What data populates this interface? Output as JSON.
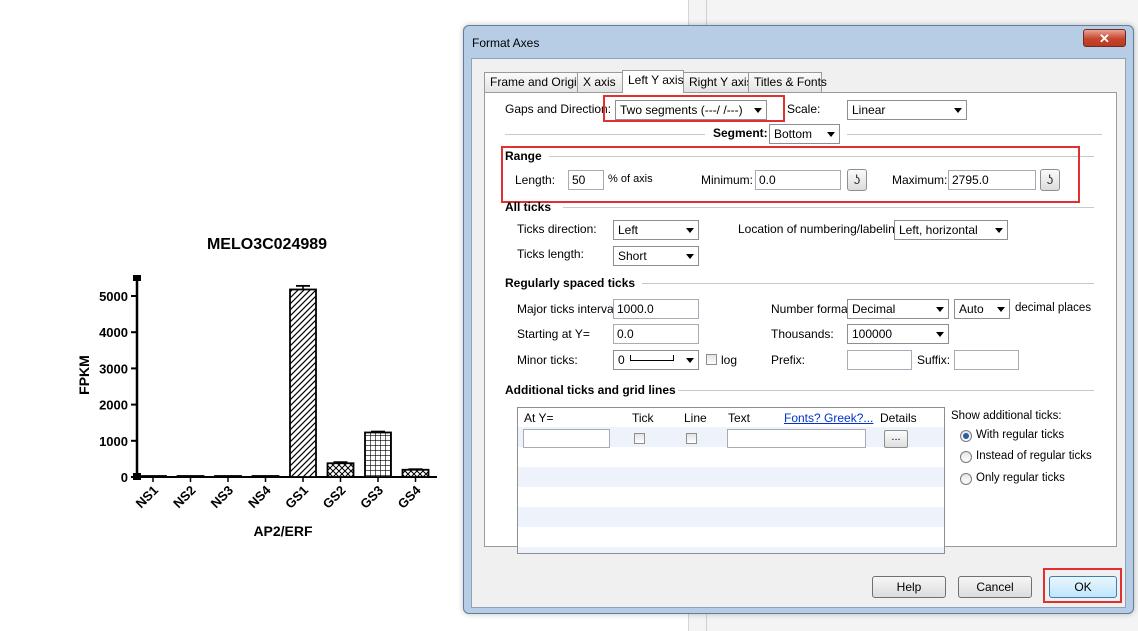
{
  "chart_data": {
    "type": "bar",
    "title": "MELO3C024989",
    "xlabel": "AP2/ERF",
    "ylabel": "FPKM",
    "categories": [
      "NS1",
      "NS2",
      "NS3",
      "NS4",
      "GS1",
      "GS2",
      "GS3",
      "GS4"
    ],
    "values": [
      8,
      2,
      10,
      0,
      5180,
      380,
      1230,
      200
    ],
    "errors": [
      5,
      1,
      6,
      0,
      100,
      30,
      25,
      15
    ],
    "yticks": [
      "0",
      "1000",
      "2000",
      "3000",
      "4000",
      "5000"
    ],
    "ylim": [
      0,
      5500
    ],
    "patterns": [
      "solid",
      "solid",
      "solid",
      "solid",
      "hatch",
      "crosshatch",
      "grid",
      "crosshatch"
    ]
  },
  "dialog": {
    "title": "Format Axes",
    "close": "✕",
    "tabs": [
      "Frame and Origin",
      "X axis",
      "Left Y axis",
      "Right Y axis",
      "Titles & Fonts"
    ],
    "active_tab": "Left Y axis",
    "gaps_label": "Gaps and Direction:",
    "gaps_value": "Two segments (---/ /---)",
    "scale_label": "Scale:",
    "scale_value": "Linear",
    "segment_label": "Segment:",
    "segment_value": "Bottom",
    "range": {
      "heading": "Range",
      "length_label": "Length:",
      "length_value": "50",
      "length_unit": "% of axis",
      "min_label": "Minimum:",
      "min_value": "0.0",
      "max_label": "Maximum:",
      "max_value": "2795.0"
    },
    "all_ticks": {
      "heading": "All ticks",
      "direction_label": "Ticks direction:",
      "direction_value": "Left",
      "location_label": "Location of numbering/labeling:",
      "location_value": "Left, horizontal",
      "length_label": "Ticks length:",
      "length_value": "Short"
    },
    "regular": {
      "heading": "Regularly spaced ticks",
      "major_label": "Major ticks interval:",
      "major_value": "1000.0",
      "number_format_label": "Number format:",
      "number_format_value": "Decimal",
      "decimal_value": "Auto",
      "decimal_suffix": "decimal places",
      "starting_label": "Starting at Y=",
      "starting_value": "0.0",
      "thousands_label": "Thousands:",
      "thousands_value": "100000",
      "minor_label": "Minor ticks:",
      "minor_value": "0",
      "log_label": "log",
      "prefix_label": "Prefix:",
      "suffix_label": "Suffix:"
    },
    "additional": {
      "heading": "Additional ticks and grid lines",
      "columns": [
        "At Y=",
        "Tick",
        "Line",
        "Text",
        "Fonts? Greek?...",
        "Details"
      ],
      "details_button": "...",
      "show_label": "Show additional ticks:",
      "options": [
        "With regular ticks",
        "Instead of regular ticks",
        "Only regular ticks"
      ],
      "selected": "With regular ticks"
    },
    "buttons": {
      "help": "Help",
      "cancel": "Cancel",
      "ok": "OK"
    }
  }
}
